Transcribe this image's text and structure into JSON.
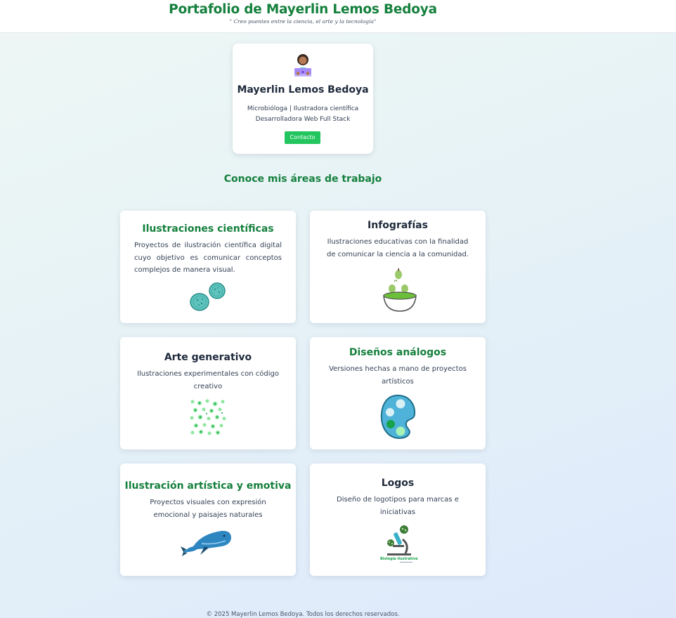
{
  "header": {
    "title": "Portafolio de Mayerlin Lemos Bedoya",
    "tagline": "\" Creo puentes entre la ciencia, el arte y la tecnología\""
  },
  "profile": {
    "avatar_icon": "woman-technologist-icon",
    "name": "Mayerlin Lemos Bedoya",
    "role_line1": "Microbióloga | Ilustradora científica",
    "role_line2": "Desarrolladora Web Full Stack",
    "contact_label": "Contacto"
  },
  "section": {
    "title": "Conoce mis áreas de trabajo"
  },
  "cards": [
    {
      "title": "Ilustraciones científicas",
      "description": "Proyectos de ilustración científica digital cuyo objetivo es comunicar conceptos complejos de manera visual.",
      "image": "bacteria-cells-illustration"
    },
    {
      "title": "Infografías",
      "description": "Ilustraciones educativas con la finalidad de comunicar la ciencia a la comunidad.",
      "image": "bowl-with-pears-illustration"
    },
    {
      "title": "Arte generativo",
      "description": "Ilustraciones experimentales con código creativo",
      "image": "green-dots-pattern"
    },
    {
      "title": "Diseños análogos",
      "description": "Versiones hechas a mano de proyectos artísticos",
      "image": "paint-palette-illustration"
    },
    {
      "title": "Ilustración artística y emotiva",
      "description": "Proyectos visuales con expresión emocional y paisajes naturales",
      "image": "whale-illustration"
    },
    {
      "title": "Logos",
      "description": "Diseño de logotipos para marcas e iniciativas",
      "image": "microscope-logo",
      "logo_text": "Biología ilustrativa"
    }
  ],
  "footer": {
    "text": "© 2025 Mayerlin Lemos Bedoya. Todos los derechos reservados."
  },
  "colors": {
    "accent_green": "#15803d",
    "button_green": "#22c55e",
    "text_dark": "#1e293b"
  }
}
